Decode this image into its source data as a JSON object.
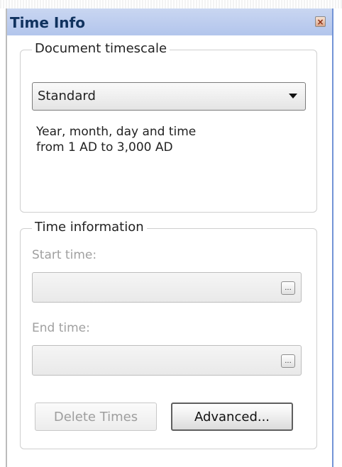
{
  "panel": {
    "title": "Time Info",
    "close_symbol": "×"
  },
  "timescale": {
    "legend": "Document timescale",
    "selected": "Standard",
    "description_line1": "Year, month, day and time",
    "description_line2": "from 1 AD to 3,000 AD"
  },
  "time_info": {
    "legend": "Time information",
    "start_label": "Start time:",
    "start_value": "",
    "end_label": "End time:",
    "end_value": "",
    "browse_symbol": "..."
  },
  "buttons": {
    "delete_label": "Delete Times",
    "advanced_label": "Advanced..."
  },
  "icons": {
    "close": "close-icon",
    "dropdown": "chevron-down-icon",
    "browse": "ellipsis-icon"
  },
  "colors": {
    "titlebar": "#c9d6f1",
    "title_text": "#10325e",
    "accent_border": "#7394d6",
    "disabled_text": "#a0a0a0"
  }
}
